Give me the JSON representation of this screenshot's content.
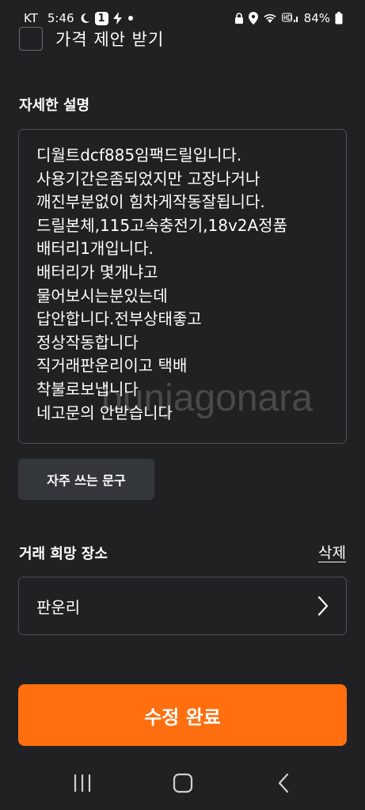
{
  "status_bar": {
    "carrier": "KT",
    "time": "5:46",
    "notification_count": "1",
    "battery": "84%"
  },
  "price_offer": {
    "label": "가격 제안 받기",
    "checked": false
  },
  "description": {
    "title": "자세한 설명",
    "lines": [
      "디월트dcf885임팩드릴입니다.",
      "사용기간은좀되었지만 고장나거나",
      "깨진부분없이 힘차게작동잘됩니다.",
      "드릴본체,115고속충전기,18v2A정품",
      "배터리1개입니다.",
      "배터리가 몇개냐고",
      "물어보시는분있는데",
      "답안합니다.전부상태좋고",
      "정상작동합니다",
      "직거래판운리이고 택배",
      "착불로보냅니다",
      "네고문의 안받습니다"
    ]
  },
  "frequent_phrases_button": "자주 쓰는 문구",
  "location": {
    "title": "거래 희망 장소",
    "delete_label": "삭제",
    "value": "판운리"
  },
  "submit_button": "수정 완료",
  "watermark": "bunjagonara",
  "icons": {
    "back": "back-icon",
    "home": "home-icon",
    "recents": "recents-icon",
    "chevron": "chevron-right-icon"
  },
  "colors": {
    "background": "#212124",
    "accent": "#ff6f0f",
    "border": "#4d4e53",
    "button_bg": "#33363b"
  }
}
